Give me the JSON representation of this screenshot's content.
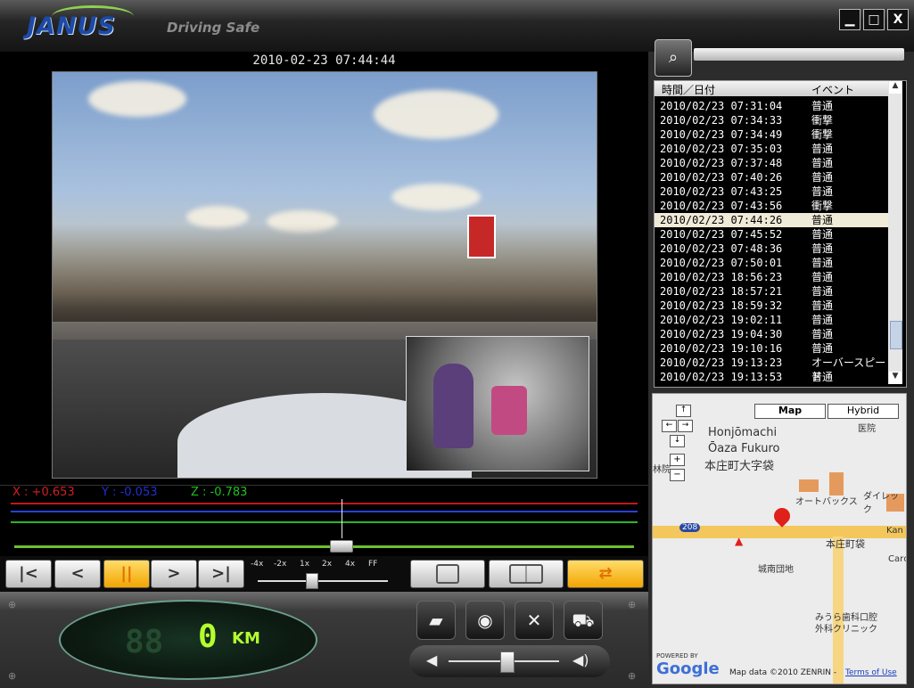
{
  "app": {
    "logo_text": "JANUS",
    "tagline": "Driving Safe"
  },
  "window_buttons": {
    "minimize": "▁",
    "maximize": "□",
    "close": "X"
  },
  "video": {
    "timestamp": "2010-02-23 07:44:44"
  },
  "accelerometer": {
    "x_label": "X : +0.653",
    "y_label": "Y : -0.053",
    "z_label": "Z : -0.783",
    "x_color": "#d02020",
    "y_color": "#2030d0",
    "z_color": "#20c020"
  },
  "playback": {
    "buttons": [
      "|<",
      "<",
      "||",
      ">",
      ">|"
    ],
    "speeds": [
      "-4x",
      "-2x",
      "1x",
      "2x",
      "4x",
      "FF"
    ],
    "view_single_icon": "single-view-icon",
    "view_split_icon": "split-view-icon",
    "swap_icon": "swap-camera-icon"
  },
  "speedometer": {
    "value": "0",
    "unit": "KM"
  },
  "function_buttons": [
    "folder-icon",
    "disc-icon",
    "tools-icon",
    "car-icon"
  ],
  "event_list": {
    "headers": [
      "時間／日付",
      "イベント"
    ],
    "rows": [
      {
        "time": "2010/02/23 07:31:04",
        "event": "普通"
      },
      {
        "time": "2010/02/23 07:34:33",
        "event": "衝撃"
      },
      {
        "time": "2010/02/23 07:34:49",
        "event": "衝撃"
      },
      {
        "time": "2010/02/23 07:35:03",
        "event": "普通"
      },
      {
        "time": "2010/02/23 07:37:48",
        "event": "普通"
      },
      {
        "time": "2010/02/23 07:40:26",
        "event": "普通"
      },
      {
        "time": "2010/02/23 07:43:25",
        "event": "普通"
      },
      {
        "time": "2010/02/23 07:43:56",
        "event": "衝撃"
      },
      {
        "time": "2010/02/23 07:44:26",
        "event": "普通"
      },
      {
        "time": "2010/02/23 07:45:52",
        "event": "普通"
      },
      {
        "time": "2010/02/23 07:48:36",
        "event": "普通"
      },
      {
        "time": "2010/02/23 07:50:01",
        "event": "普通"
      },
      {
        "time": "2010/02/23 18:56:23",
        "event": "普通"
      },
      {
        "time": "2010/02/23 18:57:21",
        "event": "普通"
      },
      {
        "time": "2010/02/23 18:59:32",
        "event": "普通"
      },
      {
        "time": "2010/02/23 19:02:11",
        "event": "普通"
      },
      {
        "time": "2010/02/23 19:04:30",
        "event": "普通"
      },
      {
        "time": "2010/02/23 19:10:16",
        "event": "普通"
      },
      {
        "time": "2010/02/23 19:13:23",
        "event": "オーバースピード"
      },
      {
        "time": "2010/02/23 19:13:53",
        "event": "普通"
      }
    ],
    "selected_index": 8
  },
  "map": {
    "type_buttons": [
      "Map",
      "Hybrid"
    ],
    "labels": [
      "Honjōmachi",
      "Ōaza Fukuro",
      "本庄町大字袋",
      "オートバックス",
      "ダイレック",
      "本庄町袋",
      "城南団地",
      "みうら歯科口腔",
      "外科クリニック",
      "医院",
      "林院",
      "Kan",
      "Carс",
      "208"
    ],
    "powered_by": "POWERED BY",
    "google": "Google",
    "attribution": "Map data ©2010 ZENRIN -",
    "terms": "Terms of Use"
  }
}
